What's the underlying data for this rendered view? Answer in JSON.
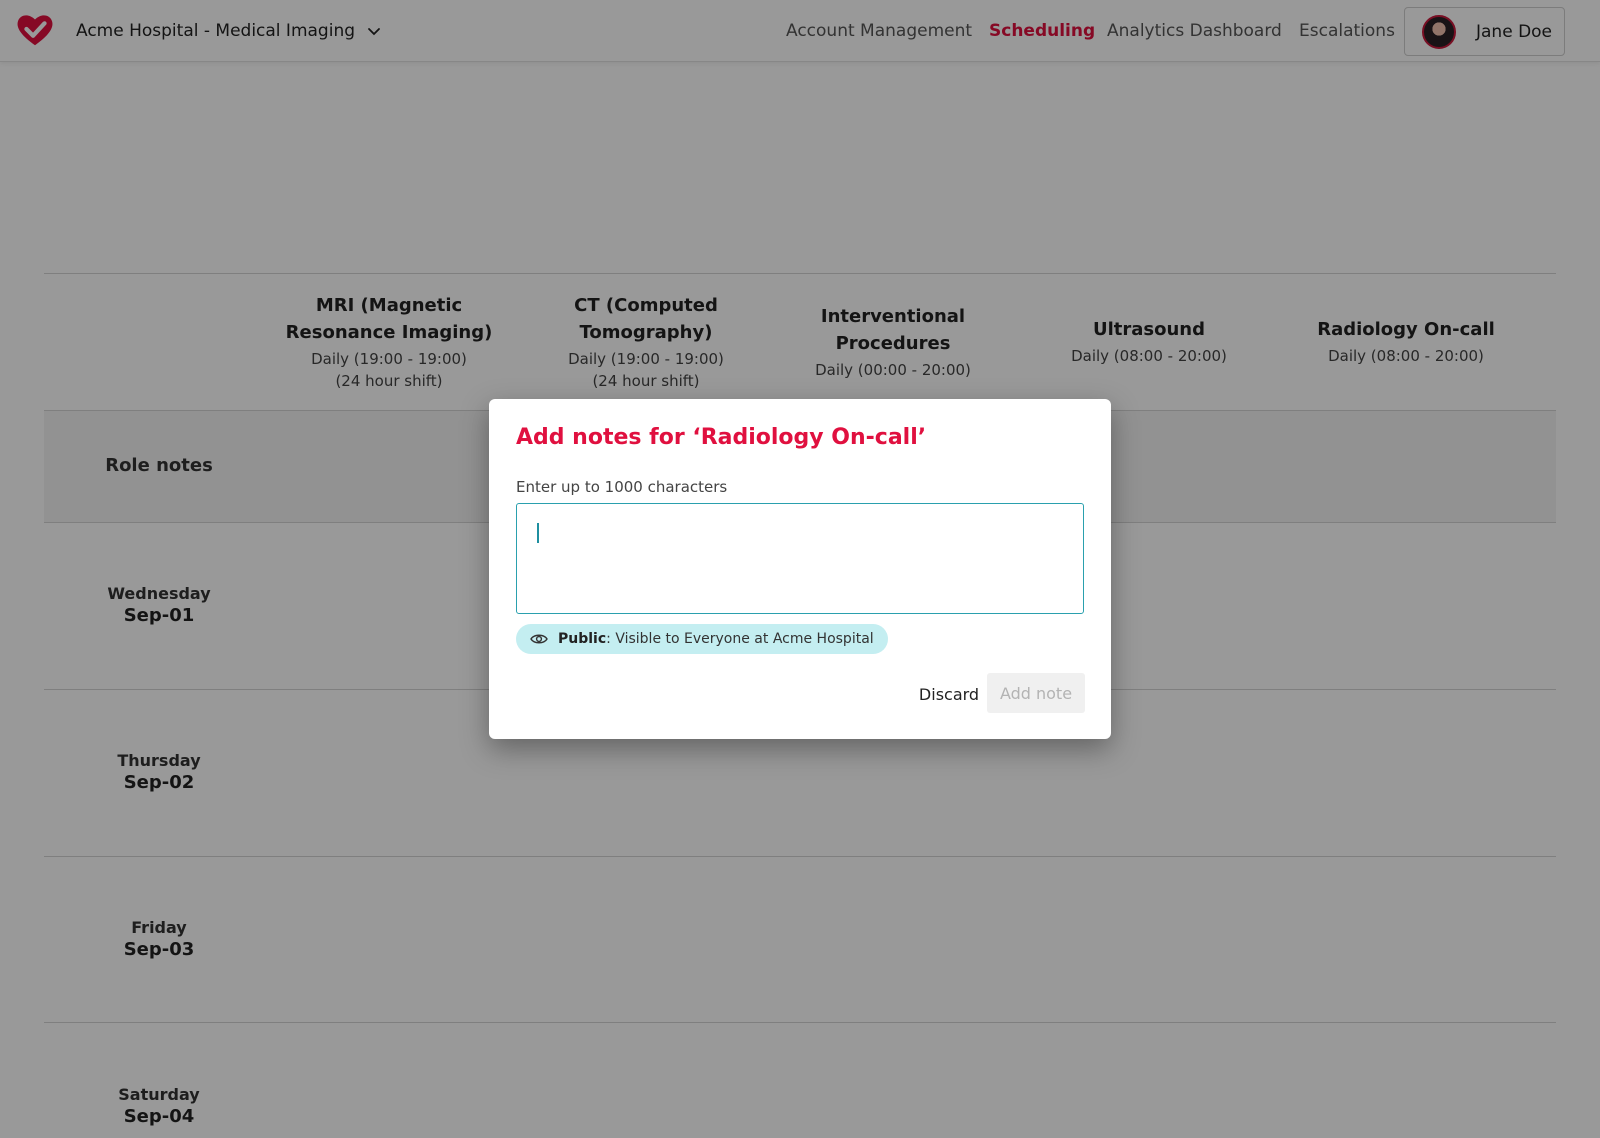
{
  "header": {
    "org_name": "Acme Hospital - Medical Imaging",
    "nav": [
      {
        "label": "Account Management",
        "active": false
      },
      {
        "label": "Scheduling",
        "active": true
      },
      {
        "label": "Analytics Dashboard",
        "active": false
      },
      {
        "label": "Escalations",
        "active": false
      }
    ],
    "user_name": "Jane Doe",
    "accent_color": "#e0103f"
  },
  "roles": [
    {
      "name": "MRI (Magnetic Resonance Imaging)",
      "schedule": "Daily (19:00 - 19:00)",
      "shift_note": "(24 hour shift)"
    },
    {
      "name": "CT (Computed Tomography)",
      "schedule": "Daily (19:00 - 19:00)",
      "shift_note": "(24 hour shift)"
    },
    {
      "name": "Interventional Procedures",
      "schedule": "Daily (00:00 - 20:00)",
      "shift_note": ""
    },
    {
      "name": "Ultrasound",
      "schedule": "Daily (08:00 - 20:00)",
      "shift_note": ""
    },
    {
      "name": "Radiology On-call",
      "schedule": "Daily (08:00 - 20:00)",
      "shift_note": ""
    }
  ],
  "role_notes_label": "Role notes",
  "days": [
    {
      "weekday": "Wednesday",
      "date": "Sep-01"
    },
    {
      "weekday": "Thursday",
      "date": "Sep-02"
    },
    {
      "weekday": "Friday",
      "date": "Sep-03"
    },
    {
      "weekday": "Saturday",
      "date": "Sep-04"
    }
  ],
  "modal": {
    "title": "Add notes for ‘Radiology On-call’",
    "field_label": "Enter up to 1000 characters",
    "input_value": "",
    "visibility_strong": "Public",
    "visibility_text": ": Visible to Everyone at Acme Hospital",
    "discard_label": "Discard",
    "add_label": "Add note",
    "add_enabled": false
  },
  "icons": {
    "logo": "heart-check-icon",
    "org_chevron": "chevron-down-icon",
    "visibility": "eye-icon"
  }
}
